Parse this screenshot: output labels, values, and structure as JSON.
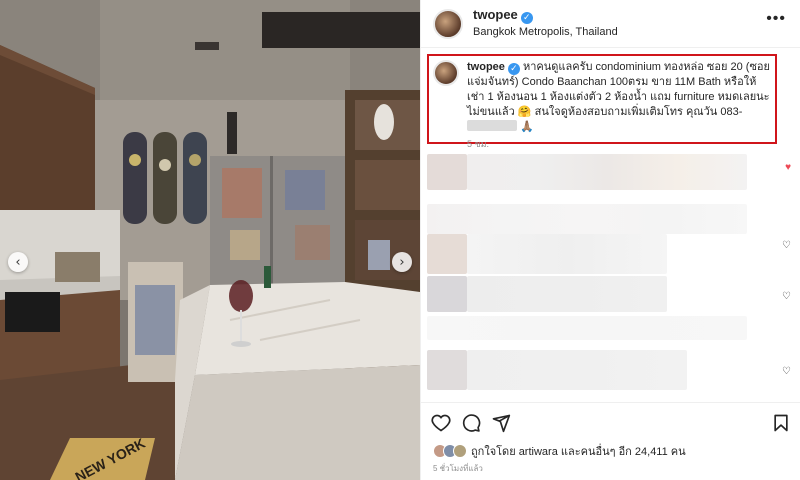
{
  "post": {
    "username": "twopee",
    "location": "Bangkok Metropolis, Thailand",
    "more_icon": "ellipsis-icon"
  },
  "caption": {
    "username": "twopee",
    "line1": "หาคนดูแลครับ condominium ทองหล่อ ซอย 20 (ซอยแจ่มจันทร์) Condo Baanchan 100ตรม ขาย 11M Bath หรือให้เช่า 1 ห้องนอน 1 ห้องแต่งตัว 2 ห้องน้ำ แถม furniture หมดเลยนะ ไม่ขนแล้ว",
    "emoji": "🤗",
    "line2": "สนใจดูห้องสอบถามเพิ่มเติมโทร คุณวัน 083-",
    "emoji_end": "🙏🏽",
    "time": "5 ชม."
  },
  "footer": {
    "likes_text": "ถูกใจโดย artiwara และคนอื่นๆ อีก 24,411 คน",
    "posted_ago": "5 ชั่วโมงที่แล้ว"
  },
  "icons": {
    "like": "heart-icon",
    "comment": "comment-icon",
    "share": "send-icon",
    "save": "bookmark-icon",
    "prev": "chevron-left-icon",
    "next": "chevron-right-icon"
  },
  "colors": {
    "highlight_border": "#d0151b",
    "verified": "#3897f0",
    "like_red": "#ed4956"
  }
}
